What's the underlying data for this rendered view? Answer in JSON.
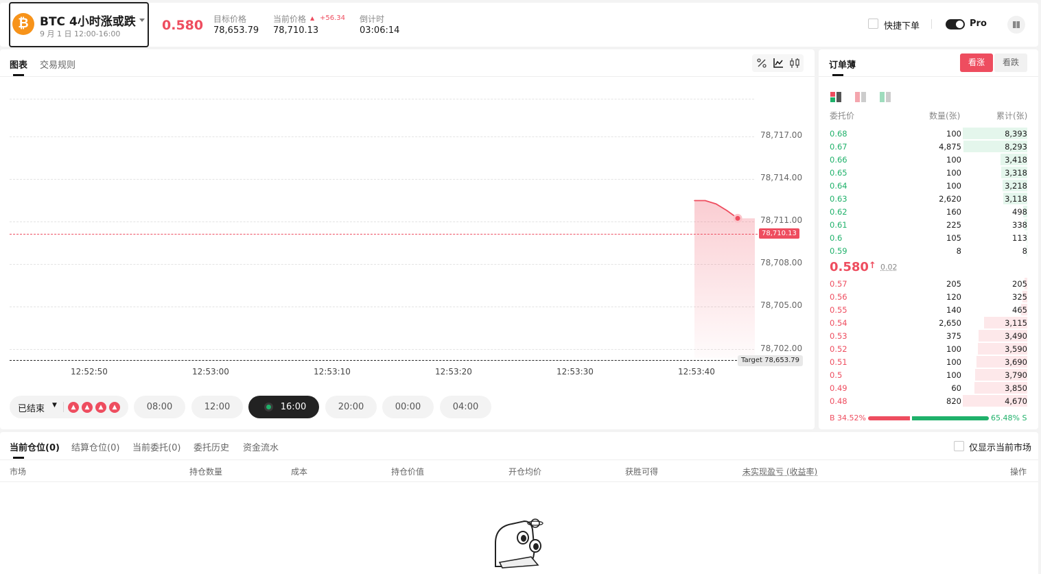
{
  "header": {
    "market_title": "BTC 4小时涨或跌",
    "market_subtitle": "9 月 1 日 12:00-16:00",
    "btc_symbol": "₿",
    "price": "0.580",
    "target_label": "目标价格",
    "target_value": "78,653.79",
    "current_label": "当前价格",
    "current_change": "+56.34",
    "current_value": "78,710.13",
    "countdown_label": "倒计时",
    "countdown_value": "03:06:14",
    "quick_order_label": "快捷下单",
    "pro_label": "Pro"
  },
  "chart_tabs": [
    {
      "label": "图表"
    },
    {
      "label": "交易规则"
    }
  ],
  "chart_tools": {
    "percent": "%",
    "line": "📈",
    "candle": "⫼"
  },
  "chart_data": {
    "type": "line",
    "x": [
      "12:53:42",
      "12:53:44",
      "12:53:46",
      "12:53:48",
      "12:53:50"
    ],
    "y": [
      78711.2,
      78711.2,
      78711.0,
      78710.6,
      78710.13
    ],
    "x_ticks": [
      "12:52:50",
      "12:53:00",
      "12:53:10",
      "12:53:20",
      "12:53:30",
      "12:53:40"
    ],
    "y_ticks": [
      "78,717.00",
      "78,714.00",
      "78,711.00",
      "78,708.00",
      "78,705.00",
      "78,702.00"
    ],
    "ylim": [
      78701,
      78719
    ],
    "current_label": "78,710.13",
    "target_label": "Target 78,653.79",
    "line_color": "#ee4d5f"
  },
  "controls": {
    "status_label": "已结束",
    "periods": [
      {
        "label": "08:00",
        "active": false
      },
      {
        "label": "12:00",
        "active": false
      },
      {
        "label": "16:00",
        "active": true
      },
      {
        "label": "20:00",
        "active": false
      },
      {
        "label": "00:00",
        "active": false
      },
      {
        "label": "04:00",
        "active": false
      }
    ]
  },
  "orderbook": {
    "title": "订单薄",
    "btn_up": "看涨",
    "btn_down": "看跌",
    "col_price": "委托价",
    "col_qty": "数量(张)",
    "col_cum": "累计(张)",
    "asks": [
      {
        "price": "0.68",
        "qty": "100",
        "cum": "8,393",
        "fill": 1.0
      },
      {
        "price": "0.67",
        "qty": "4,875",
        "cum": "8,293",
        "fill": 0.99
      },
      {
        "price": "0.66",
        "qty": "100",
        "cum": "3,418",
        "fill": 0.41
      },
      {
        "price": "0.65",
        "qty": "100",
        "cum": "3,318",
        "fill": 0.4
      },
      {
        "price": "0.64",
        "qty": "100",
        "cum": "3,218",
        "fill": 0.38
      },
      {
        "price": "0.63",
        "qty": "2,620",
        "cum": "3,118",
        "fill": 0.37
      },
      {
        "price": "0.62",
        "qty": "160",
        "cum": "498",
        "fill": 0.06
      },
      {
        "price": "0.61",
        "qty": "225",
        "cum": "338",
        "fill": 0.04
      },
      {
        "price": "0.6",
        "qty": "105",
        "cum": "113",
        "fill": 0.014
      },
      {
        "price": "0.59",
        "qty": "8",
        "cum": "8",
        "fill": 0.001
      }
    ],
    "last_price": "0.580",
    "last_change": "0.02",
    "bids": [
      {
        "price": "0.57",
        "qty": "205",
        "cum": "205",
        "fill": 0.044
      },
      {
        "price": "0.56",
        "qty": "120",
        "cum": "325",
        "fill": 0.07
      },
      {
        "price": "0.55",
        "qty": "140",
        "cum": "465",
        "fill": 0.1
      },
      {
        "price": "0.54",
        "qty": "2,650",
        "cum": "3,115",
        "fill": 0.67
      },
      {
        "price": "0.53",
        "qty": "375",
        "cum": "3,490",
        "fill": 0.75
      },
      {
        "price": "0.52",
        "qty": "100",
        "cum": "3,590",
        "fill": 0.77
      },
      {
        "price": "0.51",
        "qty": "100",
        "cum": "3,690",
        "fill": 0.79
      },
      {
        "price": "0.5",
        "qty": "100",
        "cum": "3,790",
        "fill": 0.81
      },
      {
        "price": "0.49",
        "qty": "60",
        "cum": "3,850",
        "fill": 0.82
      },
      {
        "price": "0.48",
        "qty": "820",
        "cum": "4,670",
        "fill": 1.0
      }
    ],
    "buy_ratio_label": "B 34.52%",
    "sell_ratio_label": "65.48% S",
    "buy_ratio": 0.3452
  },
  "positions": {
    "tabs": [
      {
        "label": "当前仓位(0)"
      },
      {
        "label": "结算仓位(0)"
      },
      {
        "label": "当前委托(0)"
      },
      {
        "label": "委托历史"
      },
      {
        "label": "资金流水"
      }
    ],
    "only_current_label": "仅显示当前市场",
    "columns": [
      {
        "label": "市场"
      },
      {
        "label": "持仓数量"
      },
      {
        "label": "成本"
      },
      {
        "label": "持仓价值"
      },
      {
        "label": "开仓均价"
      },
      {
        "label": "获胜可得"
      },
      {
        "label": "未实现盈亏 (收益率)"
      },
      {
        "label": "操作"
      }
    ]
  }
}
